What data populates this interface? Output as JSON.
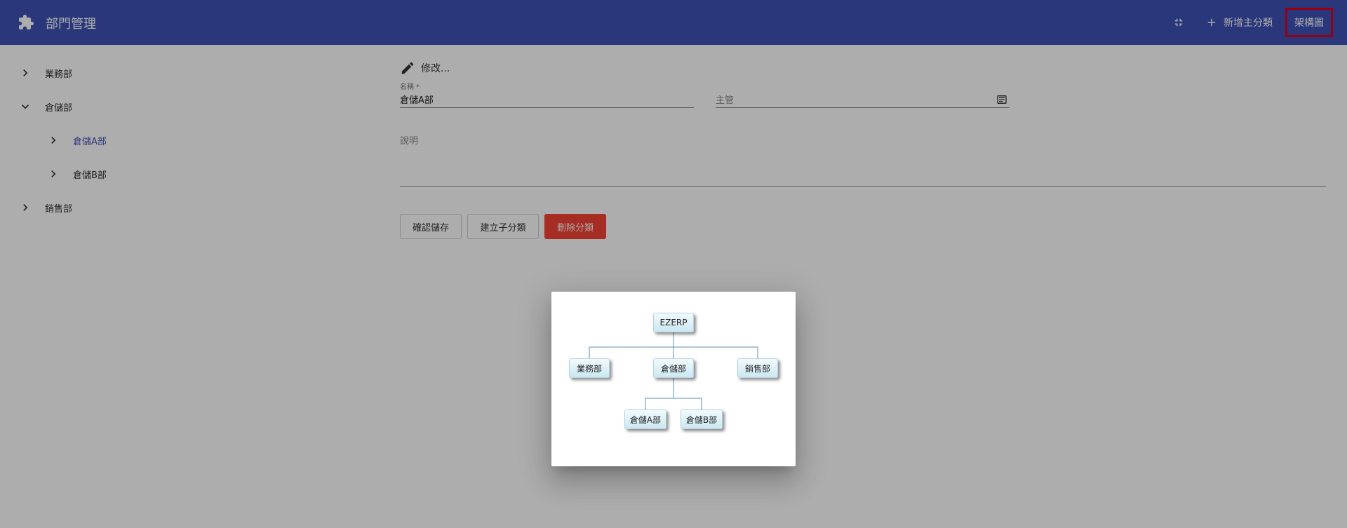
{
  "appbar": {
    "title": "部門管理",
    "icons": {
      "logo": "puzzle-icon",
      "collapse": "collapse-icon",
      "add": "plus-icon"
    },
    "add_label": "新增主分類",
    "chart_label": "架構圖",
    "background": "#3f51b5"
  },
  "tree": {
    "items": [
      {
        "label": "業務部",
        "expanded": false,
        "depth": 0
      },
      {
        "label": "倉儲部",
        "expanded": true,
        "depth": 0
      },
      {
        "label": "倉儲A部",
        "expanded": false,
        "depth": 1,
        "selected": true
      },
      {
        "label": "倉儲B部",
        "expanded": false,
        "depth": 1
      },
      {
        "label": "銷售部",
        "expanded": false,
        "depth": 0
      }
    ]
  },
  "form": {
    "mode_label": "修改...",
    "name": {
      "label": "名稱 *",
      "value": "倉儲A部"
    },
    "manager": {
      "placeholder": "主管"
    },
    "description": {
      "placeholder": "說明"
    },
    "buttons": {
      "save": "確認儲存",
      "add_child": "建立子分類",
      "delete": "刪除分類"
    },
    "danger_color": "#f44336"
  },
  "org_chart": {
    "root": "EZERP",
    "level1": [
      "業務部",
      "倉儲部",
      "銷售部"
    ],
    "level2": [
      "倉儲A部",
      "倉儲B部"
    ],
    "line_color": "#5b8db0"
  },
  "highlight_color": "#e0001a"
}
